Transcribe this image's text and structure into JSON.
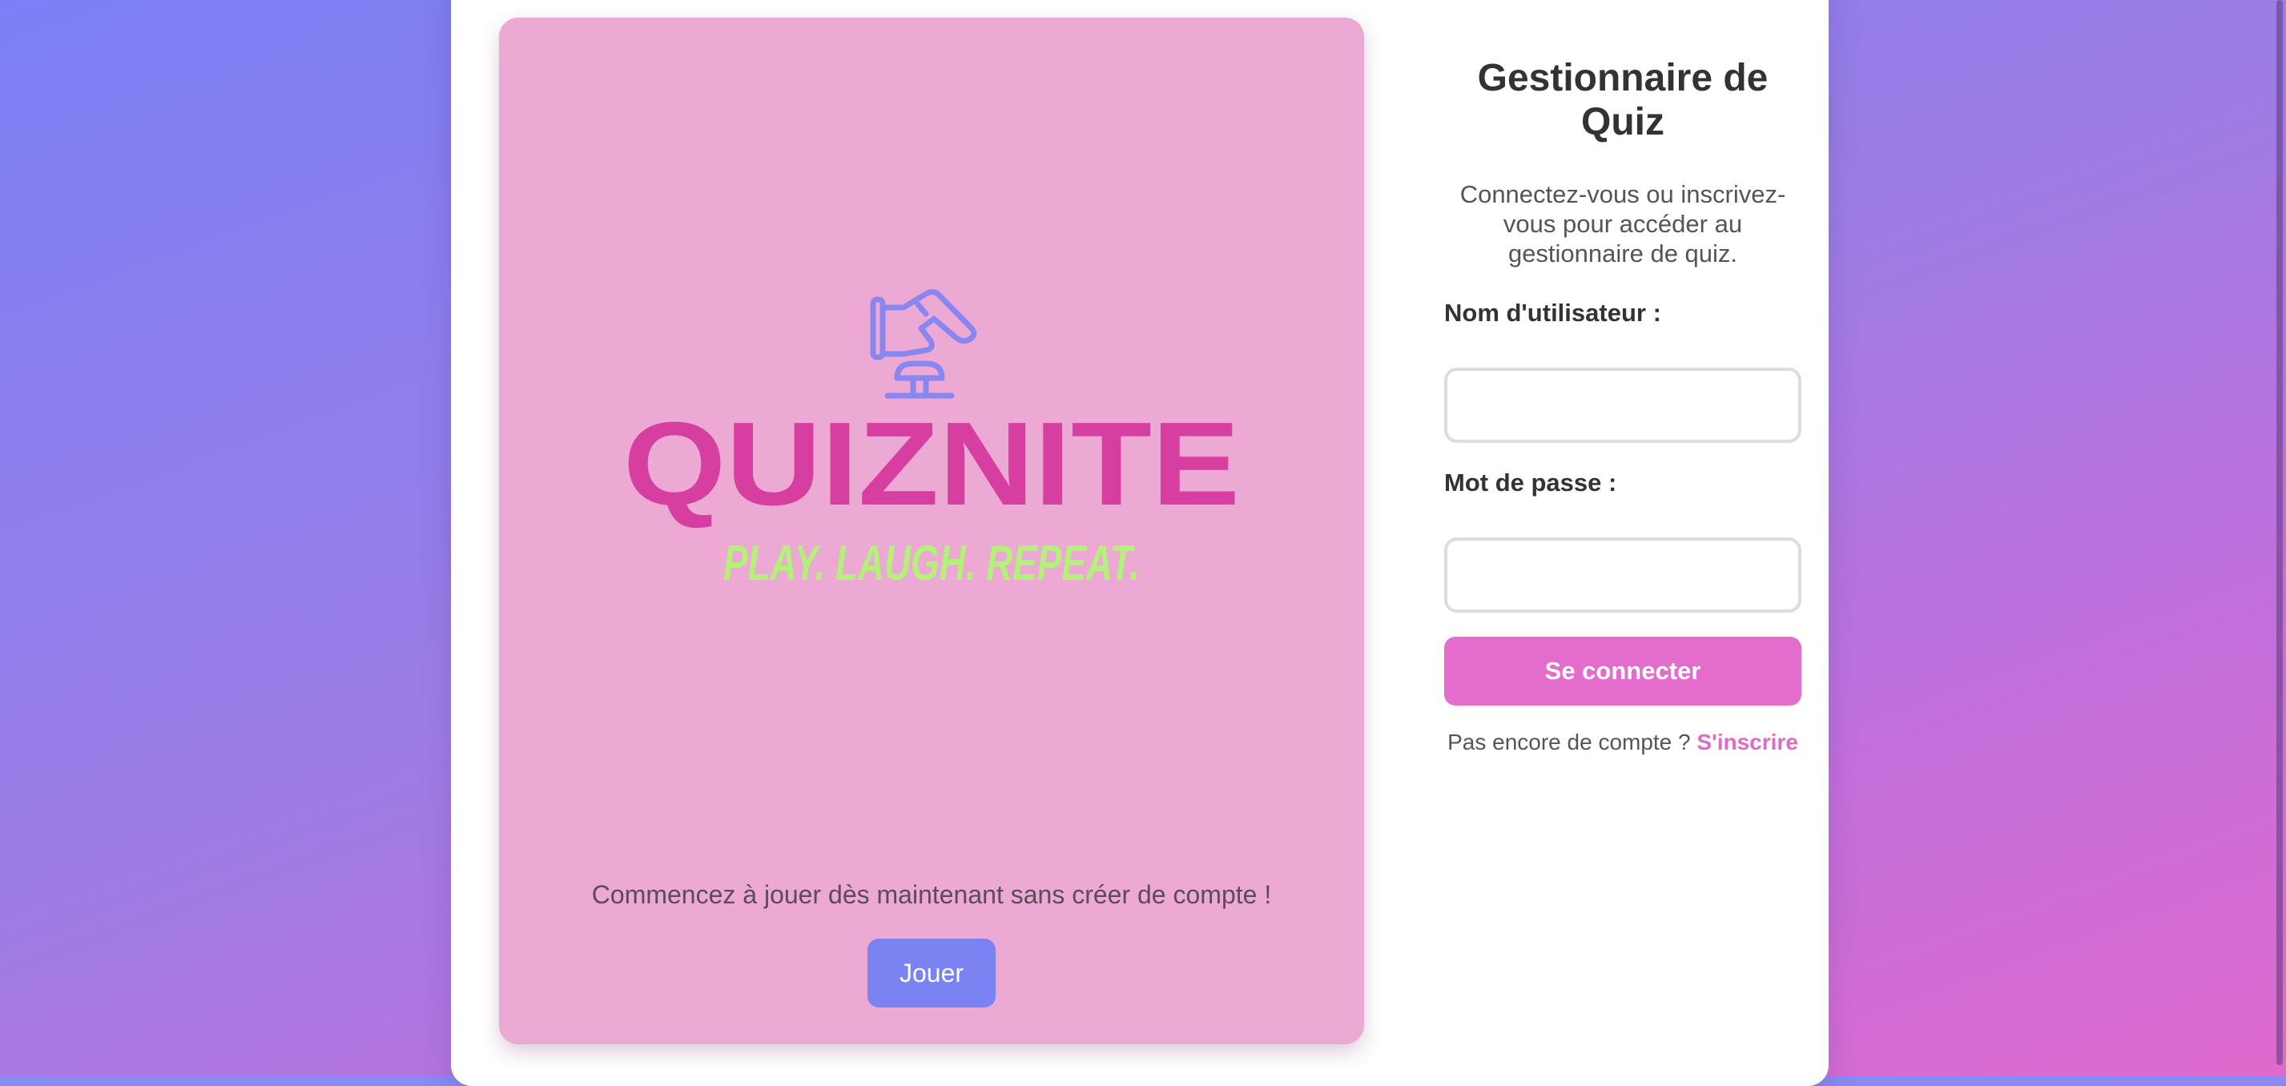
{
  "colors": {
    "accent_pink": "#e36ccc",
    "accent_blue": "#7b83f2",
    "panel_pink": "#eba9d3",
    "logo_magenta": "#d63fa0",
    "tagline_green": "#b4f07a"
  },
  "logo": {
    "brand": "QUIZNITE",
    "tagline": "PLAY. LAUGH. REPEAT.",
    "icon": "hand-buzzer-icon"
  },
  "guest": {
    "text": "Commencez à jouer dès maintenant sans créer de compte !",
    "play_label": "Jouer"
  },
  "auth": {
    "title": "Gestionnaire de Quiz",
    "subtitle": "Connectez-vous ou inscrivez-vous pour accéder au gestionnaire de quiz.",
    "username_label": "Nom d'utilisateur :",
    "username_value": "",
    "password_label": "Mot de passe :",
    "password_value": "",
    "login_label": "Se connecter",
    "signup_prompt": "Pas encore de compte ?",
    "signup_link": "S'inscrire"
  }
}
